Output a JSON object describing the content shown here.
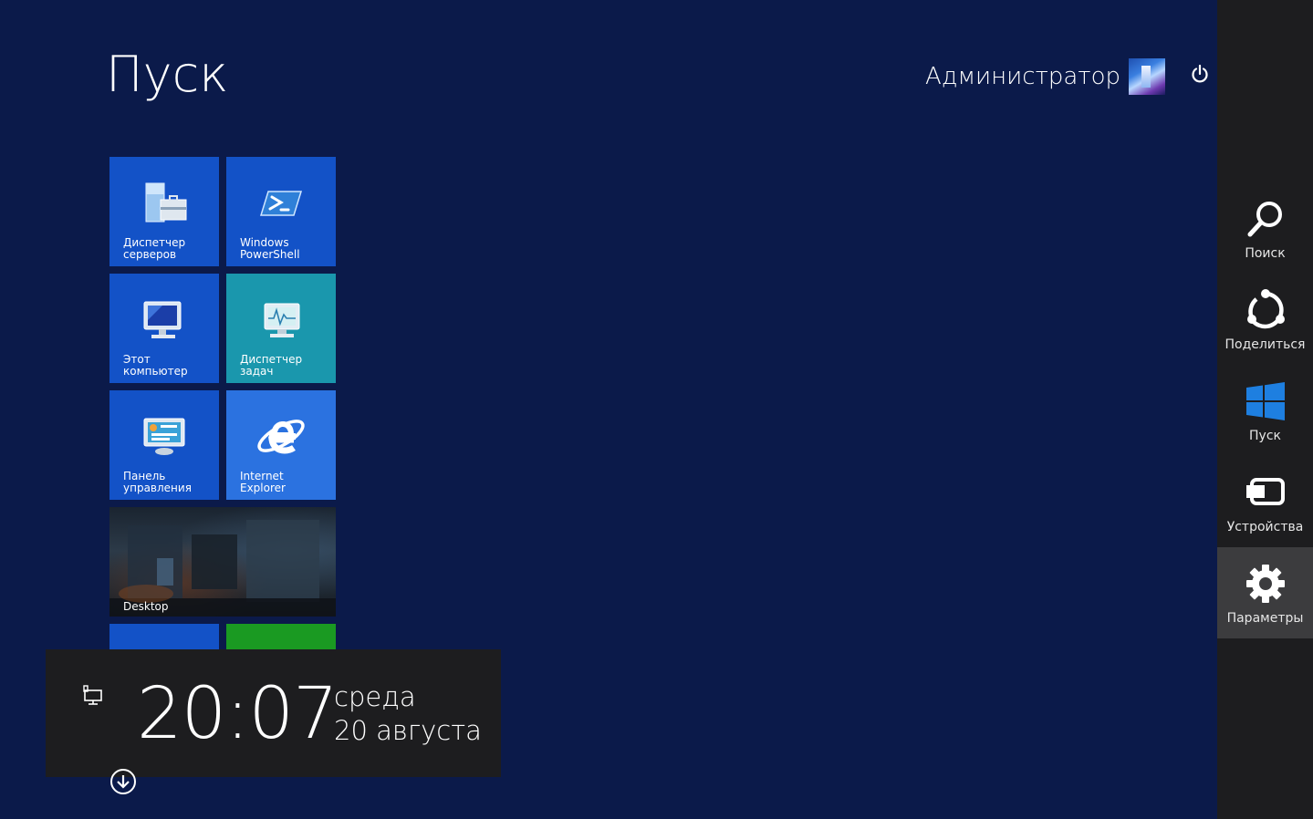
{
  "header": {
    "title": "Пуск",
    "user_name": "Администратор",
    "avatar_icon": "user-avatar-image",
    "power_icon": "power-icon"
  },
  "tiles": [
    {
      "label": "Диспетчер серверов",
      "icon": "server-manager-icon",
      "color": "#1352c7"
    },
    {
      "label": "Windows PowerShell",
      "icon": "powershell-icon",
      "color": "#1352c7"
    },
    {
      "label": "Этот компьютер",
      "icon": "computer-icon",
      "color": "#1352c7"
    },
    {
      "label": "Диспетчер задач",
      "icon": "task-manager-icon",
      "color": "#1a97ad"
    },
    {
      "label": "Панель управления",
      "icon": "control-panel-icon",
      "color": "#1352c7"
    },
    {
      "label": "Internet Explorer",
      "icon": "internet-explorer-icon",
      "color": "#2b72e0"
    },
    {
      "label": "Desktop",
      "icon": "desktop-wallpaper",
      "color": "#1a2430"
    },
    {
      "label": "",
      "icon": "administrative-tools-icon",
      "color": "#1352c7"
    },
    {
      "label": "",
      "icon": "store-icon",
      "color": "#1a9a22"
    }
  ],
  "clock": {
    "time": "20:07",
    "day": "среда",
    "date": "20 августа",
    "network_icon": "network-icon"
  },
  "scroll_icon": "arrow-down-circle-icon",
  "charms": [
    {
      "label": "Поиск",
      "icon": "search-icon"
    },
    {
      "label": "Поделиться",
      "icon": "share-icon"
    },
    {
      "label": "Пуск",
      "icon": "windows-logo-icon",
      "accent": "#1e7fe0"
    },
    {
      "label": "Устройства",
      "icon": "devices-icon"
    },
    {
      "label": "Параметры",
      "icon": "gear-icon",
      "active": true
    }
  ]
}
